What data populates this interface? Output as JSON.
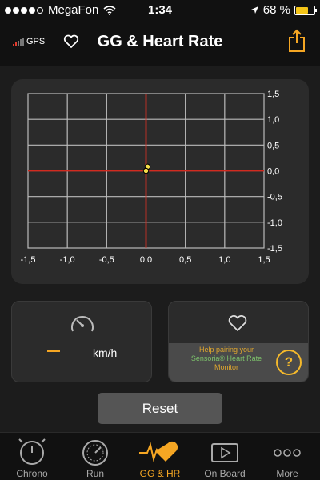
{
  "status_bar": {
    "carrier": "MegaFon",
    "time": "1:34",
    "battery_percent": "68 %",
    "battery_level": 0.68,
    "signal_dots_filled": 4,
    "signal_dots_total": 5
  },
  "nav": {
    "title": "GG & Heart Rate",
    "gps_label": "GPS",
    "gps_bars_on": 2,
    "gps_bars_total": 5,
    "accent_color": "#f5a623"
  },
  "chart_data": {
    "type": "scatter",
    "x_ticks": [
      "-1,5",
      "-1,0",
      "-0,5",
      "0,0",
      "0,5",
      "1,0",
      "1,5"
    ],
    "y_ticks": [
      "1,5",
      "1,0",
      "0,5",
      "0,0",
      "-0,5",
      "-1,0",
      "-1,5"
    ],
    "xlim": [
      -1.5,
      1.5
    ],
    "ylim": [
      -1.5,
      1.5
    ],
    "grid": true,
    "points": [
      {
        "x": 0.02,
        "y": 0.08
      },
      {
        "x": 0.0,
        "y": 0.0
      }
    ],
    "point_color": "#f5e04a",
    "axis_color": "#d22a1f",
    "grid_color": "#bbbbbb"
  },
  "speed": {
    "value": "–",
    "unit": "km/h"
  },
  "heart_rate": {
    "help_line1": "Help pairing your",
    "help_brand": "Sensoria® Heart Rate",
    "help_line3": "Monitor",
    "help_button": "?"
  },
  "reset_label": "Reset",
  "tabs": [
    {
      "label": "Chrono",
      "icon": "stopwatch-icon",
      "active": false
    },
    {
      "label": "Run",
      "icon": "speedometer-icon",
      "active": false
    },
    {
      "label": "GG & HR",
      "icon": "heartbeat-icon",
      "active": true
    },
    {
      "label": "On Board",
      "icon": "video-icon",
      "active": false
    },
    {
      "label": "More",
      "icon": "more-icon",
      "active": false
    }
  ]
}
